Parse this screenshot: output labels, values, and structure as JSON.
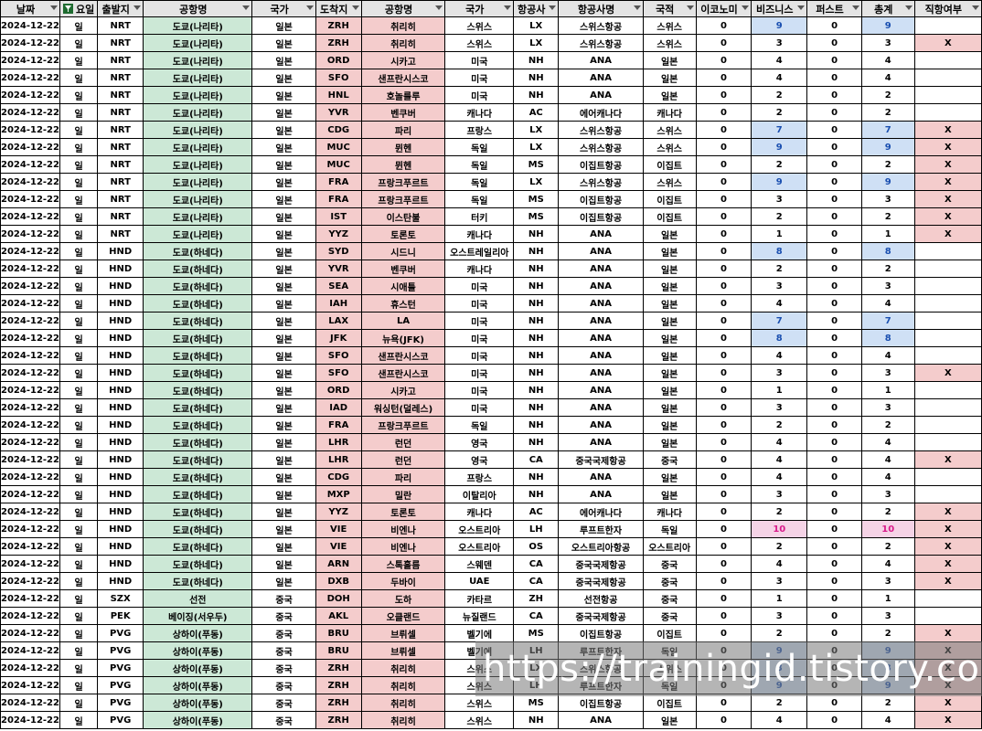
{
  "headers": {
    "date": "날짜",
    "dow": "요일",
    "dep": "출발지",
    "dep_name": "공항명",
    "dep_country": "국가",
    "arr": "도착지",
    "arr_name": "공항명",
    "arr_country": "국가",
    "airline": "항공사",
    "airline_name": "항공사명",
    "nationality": "국적",
    "economy": "이코노미",
    "business": "비즈니스",
    "first": "퍼스트",
    "total": "총계",
    "direct": "직항여부"
  },
  "colors": {
    "header_bg": "#e4e4e4",
    "economy_header": "#f4b6b6",
    "business_header": "#9fc1ec",
    "first_header": "#fff1a6",
    "total_header": "#c4cdd6",
    "dep_name_fill": "#cce8d6",
    "arr_fill": "#f4cccc",
    "highlight_blue": "#cfe0f5",
    "highlight_magenta": "#f5d3e6"
  },
  "rows": [
    [
      "2024-12-22",
      "일",
      "NRT",
      "도쿄(나리타)",
      "일본",
      "ZRH",
      "취리히",
      "스위스",
      "LX",
      "스위스항공",
      "스위스",
      "0",
      "9",
      "0",
      "9",
      ""
    ],
    [
      "2024-12-22",
      "일",
      "NRT",
      "도쿄(나리타)",
      "일본",
      "ZRH",
      "취리히",
      "스위스",
      "LX",
      "스위스항공",
      "스위스",
      "0",
      "3",
      "0",
      "3",
      "X"
    ],
    [
      "2024-12-22",
      "일",
      "NRT",
      "도쿄(나리타)",
      "일본",
      "ORD",
      "시카고",
      "미국",
      "NH",
      "ANA",
      "일본",
      "0",
      "4",
      "0",
      "4",
      ""
    ],
    [
      "2024-12-22",
      "일",
      "NRT",
      "도쿄(나리타)",
      "일본",
      "SFO",
      "샌프란시스코",
      "미국",
      "NH",
      "ANA",
      "일본",
      "0",
      "4",
      "0",
      "4",
      ""
    ],
    [
      "2024-12-22",
      "일",
      "NRT",
      "도쿄(나리타)",
      "일본",
      "HNL",
      "호놀룰루",
      "미국",
      "NH",
      "ANA",
      "일본",
      "0",
      "2",
      "0",
      "2",
      ""
    ],
    [
      "2024-12-22",
      "일",
      "NRT",
      "도쿄(나리타)",
      "일본",
      "YVR",
      "벤쿠버",
      "캐나다",
      "AC",
      "에어캐나다",
      "캐나다",
      "0",
      "2",
      "0",
      "2",
      ""
    ],
    [
      "2024-12-22",
      "일",
      "NRT",
      "도쿄(나리타)",
      "일본",
      "CDG",
      "파리",
      "프랑스",
      "LX",
      "스위스항공",
      "스위스",
      "0",
      "7",
      "0",
      "7",
      "X"
    ],
    [
      "2024-12-22",
      "일",
      "NRT",
      "도쿄(나리타)",
      "일본",
      "MUC",
      "뮌헨",
      "독일",
      "LX",
      "스위스항공",
      "스위스",
      "0",
      "9",
      "0",
      "9",
      "X"
    ],
    [
      "2024-12-22",
      "일",
      "NRT",
      "도쿄(나리타)",
      "일본",
      "MUC",
      "뮌헨",
      "독일",
      "MS",
      "이집트항공",
      "이집트",
      "0",
      "2",
      "0",
      "2",
      "X"
    ],
    [
      "2024-12-22",
      "일",
      "NRT",
      "도쿄(나리타)",
      "일본",
      "FRA",
      "프랑크푸르트",
      "독일",
      "LX",
      "스위스항공",
      "스위스",
      "0",
      "9",
      "0",
      "9",
      "X"
    ],
    [
      "2024-12-22",
      "일",
      "NRT",
      "도쿄(나리타)",
      "일본",
      "FRA",
      "프랑크푸르트",
      "독일",
      "MS",
      "이집트항공",
      "이집트",
      "0",
      "3",
      "0",
      "3",
      "X"
    ],
    [
      "2024-12-22",
      "일",
      "NRT",
      "도쿄(나리타)",
      "일본",
      "IST",
      "이스탄불",
      "터키",
      "MS",
      "이집트항공",
      "이집트",
      "0",
      "2",
      "0",
      "2",
      "X"
    ],
    [
      "2024-12-22",
      "일",
      "NRT",
      "도쿄(나리타)",
      "일본",
      "YYZ",
      "토론토",
      "캐나다",
      "NH",
      "ANA",
      "일본",
      "0",
      "1",
      "0",
      "1",
      "X"
    ],
    [
      "2024-12-22",
      "일",
      "HND",
      "도쿄(하네다)",
      "일본",
      "SYD",
      "시드니",
      "오스트레일리아",
      "NH",
      "ANA",
      "일본",
      "0",
      "8",
      "0",
      "8",
      ""
    ],
    [
      "2024-12-22",
      "일",
      "HND",
      "도쿄(하네다)",
      "일본",
      "YVR",
      "벤쿠버",
      "캐나다",
      "NH",
      "ANA",
      "일본",
      "0",
      "2",
      "0",
      "2",
      ""
    ],
    [
      "2024-12-22",
      "일",
      "HND",
      "도쿄(하네다)",
      "일본",
      "SEA",
      "시애틀",
      "미국",
      "NH",
      "ANA",
      "일본",
      "0",
      "3",
      "0",
      "3",
      ""
    ],
    [
      "2024-12-22",
      "일",
      "HND",
      "도쿄(하네다)",
      "일본",
      "IAH",
      "휴스턴",
      "미국",
      "NH",
      "ANA",
      "일본",
      "0",
      "4",
      "0",
      "4",
      ""
    ],
    [
      "2024-12-22",
      "일",
      "HND",
      "도쿄(하네다)",
      "일본",
      "LAX",
      "LA",
      "미국",
      "NH",
      "ANA",
      "일본",
      "0",
      "7",
      "0",
      "7",
      ""
    ],
    [
      "2024-12-22",
      "일",
      "HND",
      "도쿄(하네다)",
      "일본",
      "JFK",
      "뉴욕(JFK)",
      "미국",
      "NH",
      "ANA",
      "일본",
      "0",
      "8",
      "0",
      "8",
      ""
    ],
    [
      "2024-12-22",
      "일",
      "HND",
      "도쿄(하네다)",
      "일본",
      "SFO",
      "샌프란시스코",
      "미국",
      "NH",
      "ANA",
      "일본",
      "0",
      "4",
      "0",
      "4",
      ""
    ],
    [
      "2024-12-22",
      "일",
      "HND",
      "도쿄(하네다)",
      "일본",
      "SFO",
      "샌프란시스코",
      "미국",
      "NH",
      "ANA",
      "일본",
      "0",
      "3",
      "0",
      "3",
      "X"
    ],
    [
      "2024-12-22",
      "일",
      "HND",
      "도쿄(하네다)",
      "일본",
      "ORD",
      "시카고",
      "미국",
      "NH",
      "ANA",
      "일본",
      "0",
      "1",
      "0",
      "1",
      ""
    ],
    [
      "2024-12-22",
      "일",
      "HND",
      "도쿄(하네다)",
      "일본",
      "IAD",
      "워싱턴(덜레스)",
      "미국",
      "NH",
      "ANA",
      "일본",
      "0",
      "3",
      "0",
      "3",
      ""
    ],
    [
      "2024-12-22",
      "일",
      "HND",
      "도쿄(하네다)",
      "일본",
      "FRA",
      "프랑크푸르트",
      "독일",
      "NH",
      "ANA",
      "일본",
      "0",
      "2",
      "0",
      "2",
      ""
    ],
    [
      "2024-12-22",
      "일",
      "HND",
      "도쿄(하네다)",
      "일본",
      "LHR",
      "런던",
      "영국",
      "NH",
      "ANA",
      "일본",
      "0",
      "4",
      "0",
      "4",
      ""
    ],
    [
      "2024-12-22",
      "일",
      "HND",
      "도쿄(하네다)",
      "일본",
      "LHR",
      "런던",
      "영국",
      "CA",
      "중국국제항공",
      "중국",
      "0",
      "4",
      "0",
      "4",
      "X"
    ],
    [
      "2024-12-22",
      "일",
      "HND",
      "도쿄(하네다)",
      "일본",
      "CDG",
      "파리",
      "프랑스",
      "NH",
      "ANA",
      "일본",
      "0",
      "4",
      "0",
      "4",
      ""
    ],
    [
      "2024-12-22",
      "일",
      "HND",
      "도쿄(하네다)",
      "일본",
      "MXP",
      "밀란",
      "이탈리아",
      "NH",
      "ANA",
      "일본",
      "0",
      "3",
      "0",
      "3",
      ""
    ],
    [
      "2024-12-22",
      "일",
      "HND",
      "도쿄(하네다)",
      "일본",
      "YYZ",
      "토론토",
      "캐나다",
      "AC",
      "에어캐나다",
      "캐나다",
      "0",
      "2",
      "0",
      "2",
      "X"
    ],
    [
      "2024-12-22",
      "일",
      "HND",
      "도쿄(하네다)",
      "일본",
      "VIE",
      "비엔나",
      "오스트리아",
      "LH",
      "루프트한자",
      "독일",
      "0",
      "10",
      "0",
      "10",
      "X"
    ],
    [
      "2024-12-22",
      "일",
      "HND",
      "도쿄(하네다)",
      "일본",
      "VIE",
      "비엔나",
      "오스트리아",
      "OS",
      "오스트리아항공",
      "오스트리아",
      "0",
      "2",
      "0",
      "2",
      "X"
    ],
    [
      "2024-12-22",
      "일",
      "HND",
      "도쿄(하네다)",
      "일본",
      "ARN",
      "스톡홀름",
      "스웨덴",
      "CA",
      "중국국제항공",
      "중국",
      "0",
      "4",
      "0",
      "4",
      "X"
    ],
    [
      "2024-12-22",
      "일",
      "HND",
      "도쿄(하네다)",
      "일본",
      "DXB",
      "두바이",
      "UAE",
      "CA",
      "중국국제항공",
      "중국",
      "0",
      "3",
      "0",
      "3",
      "X"
    ],
    [
      "2024-12-22",
      "일",
      "SZX",
      "선전",
      "중국",
      "DOH",
      "도하",
      "카타르",
      "ZH",
      "선전항공",
      "중국",
      "0",
      "1",
      "0",
      "1",
      ""
    ],
    [
      "2024-12-22",
      "일",
      "PEK",
      "베이징(서우두)",
      "중국",
      "AKL",
      "오클랜드",
      "뉴질랜드",
      "CA",
      "중국국제항공",
      "중국",
      "0",
      "3",
      "0",
      "3",
      ""
    ],
    [
      "2024-12-22",
      "일",
      "PVG",
      "상하이(푸동)",
      "중국",
      "BRU",
      "브뤼셀",
      "벨기에",
      "MS",
      "이집트항공",
      "이집트",
      "0",
      "2",
      "0",
      "2",
      "X"
    ],
    [
      "2024-12-22",
      "일",
      "PVG",
      "상하이(푸동)",
      "중국",
      "BRU",
      "브뤼셀",
      "벨기에",
      "LH",
      "루프트한자",
      "독일",
      "0",
      "9",
      "0",
      "9",
      "X"
    ],
    [
      "2024-12-22",
      "일",
      "PVG",
      "상하이(푸동)",
      "중국",
      "ZRH",
      "취리히",
      "스위스",
      "LX",
      "스위스항공",
      "스위스",
      "0",
      "8",
      "0",
      "8",
      "X"
    ],
    [
      "2024-12-22",
      "일",
      "PVG",
      "상하이(푸동)",
      "중국",
      "ZRH",
      "취리히",
      "스위스",
      "LH",
      "루프트한자",
      "독일",
      "0",
      "9",
      "0",
      "9",
      "X"
    ],
    [
      "2024-12-22",
      "일",
      "PVG",
      "상하이(푸동)",
      "중국",
      "ZRH",
      "취리히",
      "스위스",
      "MS",
      "이집트항공",
      "이집트",
      "0",
      "2",
      "0",
      "2",
      "X"
    ],
    [
      "2024-12-22",
      "일",
      "PVG",
      "상하이(푸동)",
      "중국",
      "ZRH",
      "취리히",
      "스위스",
      "NH",
      "ANA",
      "일본",
      "0",
      "4",
      "0",
      "4",
      "X"
    ]
  ],
  "watermark": "https://trainingid.tistory.com"
}
